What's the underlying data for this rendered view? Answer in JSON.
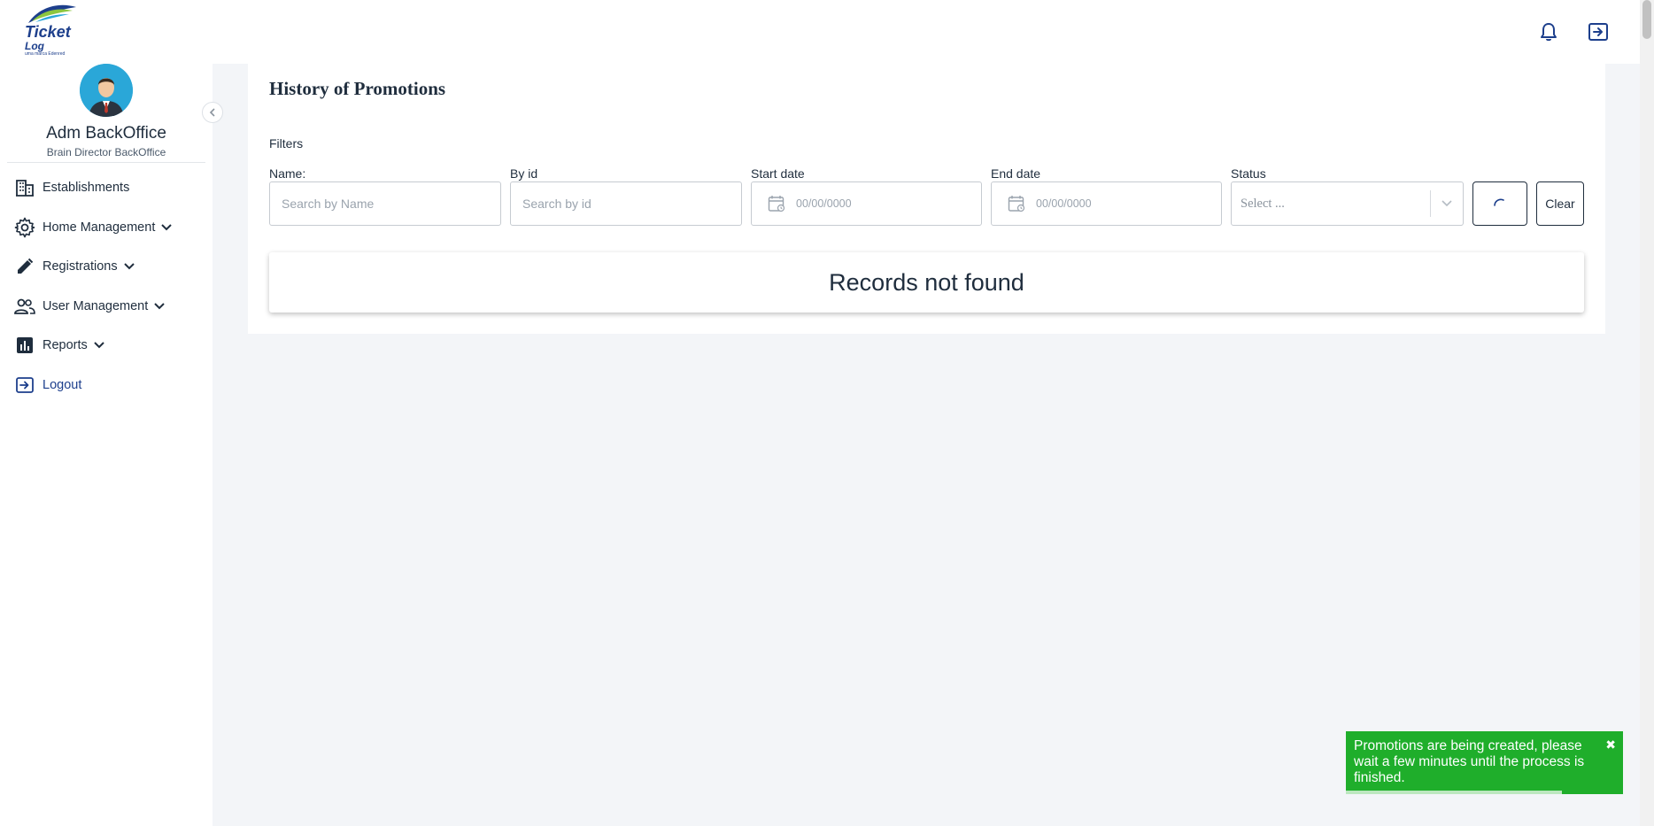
{
  "logo": {
    "brand_line1": "Ticket",
    "brand_line2": "Log",
    "tagline": "uma marca Edenred"
  },
  "header": {
    "notifications_icon": "bell-icon",
    "exit_icon": "logout-icon"
  },
  "sidebar": {
    "user_name": "Adm BackOffice",
    "user_role": "Brain Director BackOffice",
    "items": [
      {
        "label": "Establishments",
        "icon": "building-icon",
        "expandable": false
      },
      {
        "label": "Home Management",
        "icon": "gear-icon",
        "expandable": true
      },
      {
        "label": "Registrations",
        "icon": "pencil-icon",
        "expandable": true
      },
      {
        "label": "User Management",
        "icon": "users-icon",
        "expandable": true
      },
      {
        "label": "Reports",
        "icon": "chart-icon",
        "expandable": true
      },
      {
        "label": "Logout",
        "icon": "logout-icon",
        "expandable": false
      }
    ]
  },
  "page": {
    "title": "History of Promotions",
    "filters_label": "Filters",
    "filters": {
      "name": {
        "label": "Name:",
        "placeholder": "Search by Name"
      },
      "by_id": {
        "label": "By id",
        "placeholder": "Search by id"
      },
      "start_date": {
        "label": "Start date",
        "placeholder": "00/00/0000"
      },
      "end_date": {
        "label": "End date",
        "placeholder": "00/00/0000"
      },
      "status": {
        "label": "Status",
        "placeholder": "Select ..."
      }
    },
    "clear_label": "Clear",
    "empty_message": "Records not found"
  },
  "toast": {
    "message": "Promotions are being created, please wait a few minutes until the process is finished.",
    "close_glyph": "✖",
    "progress": 0.78,
    "color": "#1fae2b"
  },
  "colors": {
    "brand": "#1d3f8c",
    "accent_green": "#1fae2b",
    "avatar_bg": "#2aa7d8"
  }
}
